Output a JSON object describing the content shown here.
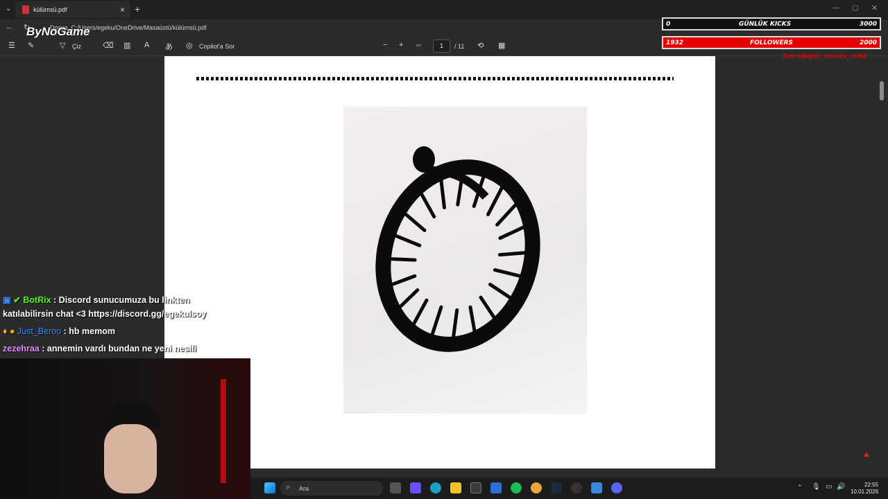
{
  "browser": {
    "tab_title": "külümsü.pdf",
    "url_label": "Dosya",
    "url": "C:/Users/egeku/OneDrive/Masaüstü/külümsü.pdf"
  },
  "pdf_toolbar": {
    "draw_label": "Çiz",
    "copilot_label": "Copilot'a Sor",
    "page_current": "1",
    "page_total": "/ 11"
  },
  "overlay": {
    "logo": "ByNoGame",
    "kicks": {
      "current": "0",
      "label": "GÜNLÜK KICKS",
      "goal": "3000"
    },
    "followers": {
      "current": "1932",
      "label": "FOLLOWERS",
      "goal": "2000"
    },
    "last_follower": "Son takipçi: xxxxxx_orbit"
  },
  "chat": [
    {
      "user": "BotRix",
      "user_color": "#53fc18",
      "text": ": Discord sunucumuza bu linkten"
    },
    {
      "user": "",
      "user_color": "#ffffff",
      "text": "katılabilirsin chat <3 https://discord.gg/egekulsoy"
    },
    {
      "user": "Just_Beroo",
      "user_color": "#3a8cff",
      "text": ": hb memom"
    },
    {
      "user": "zezehraa",
      "user_color": "#e08cff",
      "text": ": annemin vardı bundan ne yeni nesili"
    }
  ],
  "taskbar": {
    "search_placeholder": "Ara",
    "time": "22:55",
    "date": "10.01.2026"
  },
  "colors": {
    "accent_red": "#e60000",
    "pdf_red": "#d13438",
    "botrix_green": "#53fc18"
  }
}
